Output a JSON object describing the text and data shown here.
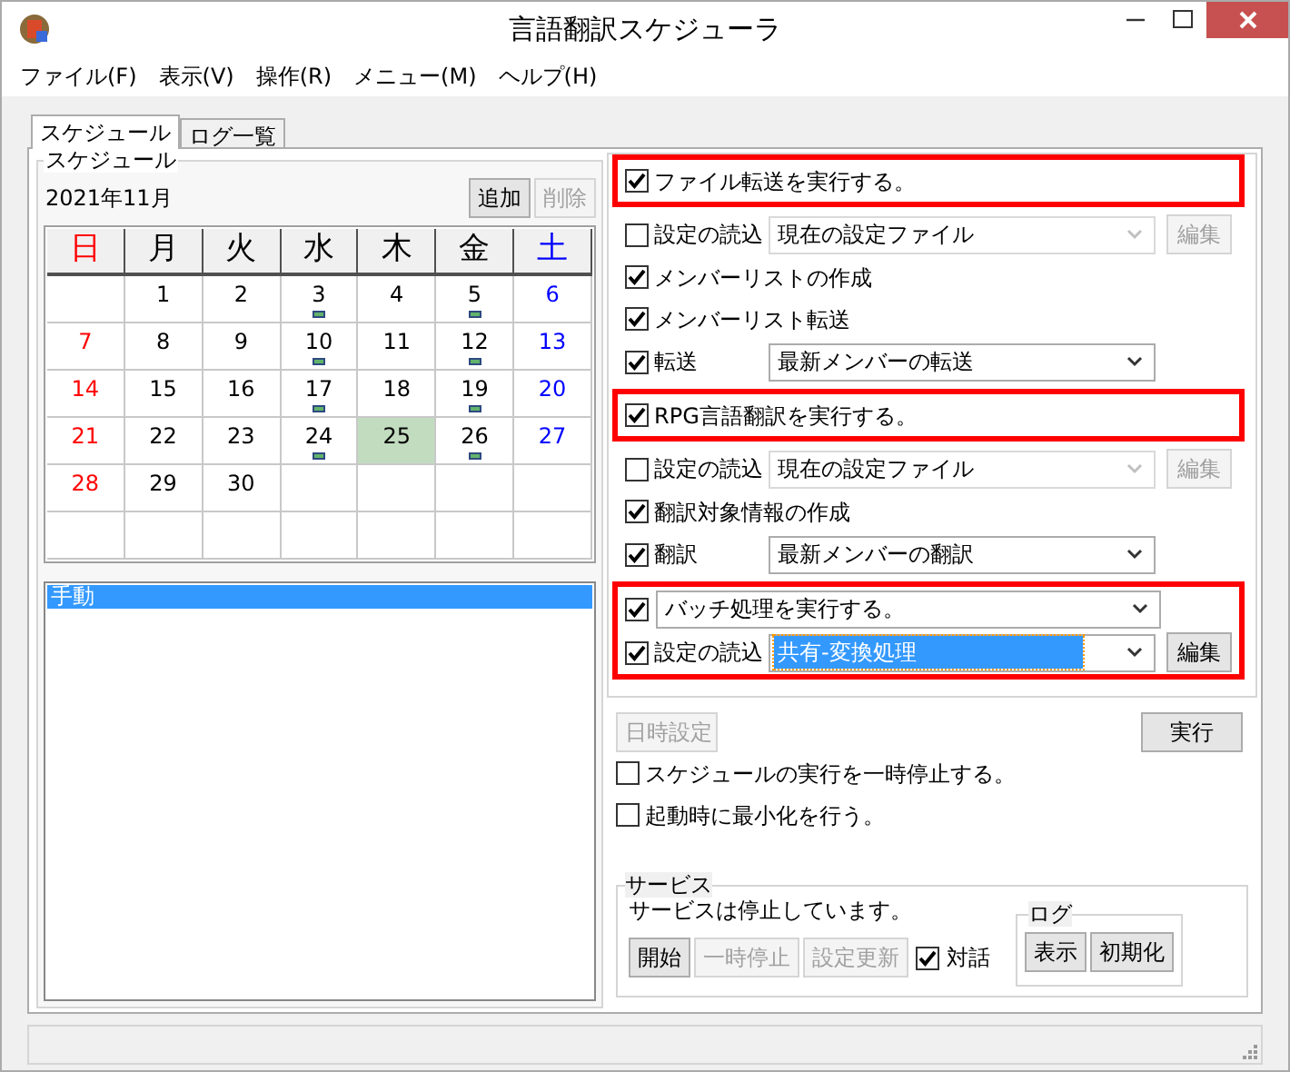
{
  "window": {
    "title": "言語翻訳スケジューラ"
  },
  "menu": [
    "ファイル(F)",
    "表示(V)",
    "操作(R)",
    "メニュー(M)",
    "ヘルプ(H)"
  ],
  "tabs": [
    {
      "label": "スケジュール",
      "selected": true
    },
    {
      "label": "ログ一覧",
      "selected": false
    }
  ],
  "schedule": {
    "group_title": "スケジュール",
    "month": "2021年11月",
    "add_button": {
      "label": "追加",
      "disabled": false
    },
    "delete_button": {
      "label": "削除",
      "disabled": true
    },
    "calendar": {
      "weekdays": [
        {
          "label": "日",
          "color": "#ff0000"
        },
        {
          "label": "月",
          "color": "#000000"
        },
        {
          "label": "火",
          "color": "#000000"
        },
        {
          "label": "水",
          "color": "#000000"
        },
        {
          "label": "木",
          "color": "#000000"
        },
        {
          "label": "金",
          "color": "#000000"
        },
        {
          "label": "土",
          "color": "#0000ff"
        }
      ],
      "weeks": [
        [
          {
            "kind": "blank"
          },
          {
            "day": "1",
            "marked": false,
            "selected": false
          },
          {
            "day": "2",
            "marked": false,
            "selected": false
          },
          {
            "day": "3",
            "marked": true,
            "selected": false
          },
          {
            "day": "4",
            "marked": false,
            "selected": false
          },
          {
            "day": "5",
            "marked": true,
            "selected": false
          },
          {
            "day": "6",
            "marked": false,
            "selected": false
          }
        ],
        [
          {
            "day": "7",
            "marked": false,
            "selected": false
          },
          {
            "day": "8",
            "marked": false,
            "selected": false
          },
          {
            "day": "9",
            "marked": false,
            "selected": false
          },
          {
            "day": "10",
            "marked": true,
            "selected": false
          },
          {
            "day": "11",
            "marked": false,
            "selected": false
          },
          {
            "day": "12",
            "marked": true,
            "selected": false
          },
          {
            "day": "13",
            "marked": false,
            "selected": false
          }
        ],
        [
          {
            "day": "14",
            "marked": false,
            "selected": false
          },
          {
            "day": "15",
            "marked": false,
            "selected": false
          },
          {
            "day": "16",
            "marked": false,
            "selected": false
          },
          {
            "day": "17",
            "marked": true,
            "selected": false
          },
          {
            "day": "18",
            "marked": false,
            "selected": false
          },
          {
            "day": "19",
            "marked": true,
            "selected": false
          },
          {
            "day": "20",
            "marked": false,
            "selected": false
          }
        ],
        [
          {
            "day": "21",
            "marked": false,
            "selected": false
          },
          {
            "day": "22",
            "marked": false,
            "selected": false
          },
          {
            "day": "23",
            "marked": false,
            "selected": false
          },
          {
            "day": "24",
            "marked": true,
            "selected": false
          },
          {
            "day": "25",
            "marked": false,
            "selected": true
          },
          {
            "day": "26",
            "marked": true,
            "selected": false
          },
          {
            "day": "27",
            "marked": false,
            "selected": false
          }
        ],
        [
          {
            "day": "28",
            "marked": false,
            "selected": false
          },
          {
            "day": "29",
            "marked": false,
            "selected": false
          },
          {
            "day": "30",
            "marked": false,
            "selected": false
          },
          {
            "kind": "blank"
          },
          {
            "kind": "blank"
          },
          {
            "kind": "blank"
          },
          {
            "kind": "blank"
          }
        ],
        [
          {
            "kind": "blank"
          },
          {
            "kind": "blank"
          },
          {
            "kind": "blank"
          },
          {
            "kind": "blank"
          },
          {
            "kind": "blank"
          },
          {
            "kind": "blank"
          },
          {
            "kind": "blank"
          }
        ]
      ]
    },
    "list": [
      {
        "label": "手動",
        "selected": true
      }
    ]
  },
  "task_blocks": [
    {
      "highlighted": true,
      "rows": [
        {
          "kind": "check",
          "label": "ファイル転送を実行する。",
          "checked": true
        }
      ]
    },
    {
      "highlighted": false,
      "rows": [
        {
          "kind": "check_select",
          "label": "設定の読込",
          "checked": false,
          "value": "現在の設定ファイル",
          "disabled": true,
          "focused": false,
          "edit": {
            "label": "編集",
            "disabled": true
          }
        },
        {
          "kind": "check",
          "label": "メンバーリストの作成",
          "checked": true
        },
        {
          "kind": "check",
          "label": "メンバーリスト転送",
          "checked": true
        },
        {
          "kind": "check_select",
          "label": "転送",
          "checked": true,
          "value": "最新メンバーの転送",
          "disabled": false,
          "focused": false
        }
      ]
    },
    {
      "highlighted": true,
      "rows": [
        {
          "kind": "check",
          "label": "RPG言語翻訳を実行する。",
          "checked": true
        }
      ]
    },
    {
      "highlighted": false,
      "rows": [
        {
          "kind": "check_select",
          "label": "設定の読込",
          "checked": false,
          "value": "現在の設定ファイル",
          "disabled": true,
          "focused": false,
          "edit": {
            "label": "編集",
            "disabled": true
          }
        },
        {
          "kind": "check",
          "label": "翻訳対象情報の作成",
          "checked": true
        },
        {
          "kind": "check_select",
          "label": "翻訳",
          "checked": true,
          "value": "最新メンバーの翻訳",
          "disabled": false,
          "focused": false
        }
      ]
    },
    {
      "highlighted": true,
      "rows": [
        {
          "kind": "check_combo",
          "checked": true,
          "value": "バッチ処理を実行する。",
          "disabled": false,
          "focused": false
        },
        {
          "kind": "check_select",
          "label": "設定の読込",
          "checked": true,
          "value": "共有-変換処理",
          "disabled": false,
          "focused": true,
          "edit": {
            "label": "編集",
            "disabled": false
          }
        }
      ]
    }
  ],
  "datetime_button": {
    "label": "日時設定",
    "disabled": true
  },
  "run_button": {
    "label": "実行",
    "disabled": false
  },
  "options": [
    {
      "label": "スケジュールの実行を一時停止する。",
      "checked": false
    },
    {
      "label": "起動時に最小化を行う。",
      "checked": false
    }
  ],
  "service": {
    "group_title": "サービス",
    "status": "サービスは停止しています。",
    "buttons": [
      {
        "label": "開始",
        "disabled": false
      },
      {
        "label": "一時停止",
        "disabled": true
      },
      {
        "label": "設定更新",
        "disabled": true
      }
    ],
    "dialog_check": {
      "label": "対話",
      "checked": true
    },
    "log": {
      "group_title": "ログ",
      "buttons": [
        {
          "label": "表示",
          "disabled": false
        },
        {
          "label": "初期化",
          "disabled": false
        }
      ]
    }
  }
}
